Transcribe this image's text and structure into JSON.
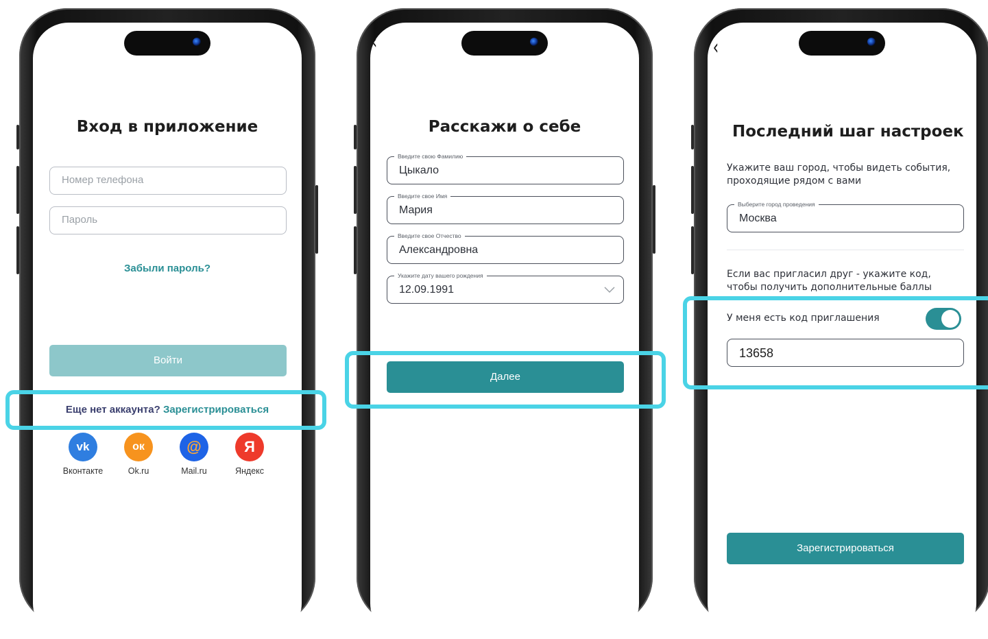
{
  "screen1": {
    "title": "Вход в приложение",
    "phone_placeholder": "Номер телефона",
    "password_placeholder": "Пароль",
    "forgot_password": "Забыли пароль?",
    "login_button": "Войти",
    "no_account_text": "Еще нет аккаунта?",
    "register_link": "Зарегистрироваться",
    "social": [
      {
        "name": "Вконтакте",
        "icon": "vk-icon",
        "glyph": "vk",
        "color": "#2f7ee0"
      },
      {
        "name": "Ok.ru",
        "icon": "ok-icon",
        "glyph": "ок",
        "color": "#f7931e"
      },
      {
        "name": "Mail.ru",
        "icon": "mail-icon",
        "glyph": "@",
        "color": "#1e63e6"
      },
      {
        "name": "Яндекс",
        "icon": "yandex-icon",
        "glyph": "Я",
        "color": "#ee3a2b"
      }
    ]
  },
  "screen2": {
    "back_icon": "chevron-left-icon",
    "title": "Расскажи о себе",
    "fields": [
      {
        "label": "Введите свою Фамилию",
        "value": "Цыкало"
      },
      {
        "label": "Введите свое Имя",
        "value": "Мария"
      },
      {
        "label": "Введите свое Отчество",
        "value": "Александровна"
      },
      {
        "label": "Укажите дату вашего рождения",
        "value": "12.09.1991"
      }
    ],
    "next_button": "Далее"
  },
  "screen3": {
    "back_icon": "chevron-left-icon",
    "title": "Последний шаг настроек",
    "city_hint": "Укажите ваш город, чтобы видеть события, проходящие рядом с вами",
    "city_label": "Выберите город проведения",
    "city_value": "Москва",
    "invite_hint": "Если вас пригласил друг - укажите код, чтобы получить дополнительные баллы",
    "invite_toggle_label": "У меня есть код приглашения",
    "invite_toggle_on": true,
    "invite_code": "13658",
    "register_button": "Зарегистрироваться"
  },
  "colors": {
    "accent": "#2a8f95",
    "accent_disabled": "#8dc7ca",
    "highlight": "#4ad3e6",
    "link": "#2a8f95"
  }
}
